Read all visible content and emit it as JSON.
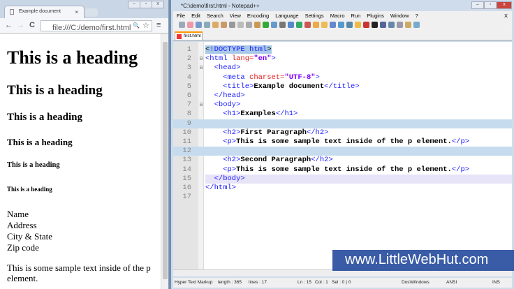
{
  "browser": {
    "tab_title": "Example document",
    "tab_close": "×",
    "url": "file:///C:/demo/first.html",
    "back": "←",
    "forward": "→",
    "reload": "C",
    "zoom_icon": "🔍",
    "star": "☆",
    "menu": "≡",
    "content": {
      "headings": [
        "This is a heading",
        "This is a heading",
        "This is a heading",
        "This is a heading",
        "This is a heading",
        "This is a heading"
      ],
      "address_lines": [
        "Name",
        "Address",
        "City & State",
        "Zip code"
      ],
      "paragraph": "This is some sample text inside of the p element."
    }
  },
  "npp": {
    "title": "*C:\\demo\\first.html - Notepad++",
    "menu": [
      "File",
      "Edit",
      "Search",
      "View",
      "Encoding",
      "Language",
      "Settings",
      "Macro",
      "Run",
      "Plugins",
      "Window",
      "?"
    ],
    "menu_close": "X",
    "tab": "first.html",
    "status": {
      "lang": "Hyper Text Markup",
      "length": "length : 365",
      "lines": "lines : 17",
      "ln": "Ln : 15",
      "col": "Col : 1",
      "sel": "Sel : 0 | 0",
      "eol": "Dos\\Windows",
      "enc": "ANSI",
      "mode": "INS"
    },
    "line_numbers": [
      "1",
      "2",
      "3",
      "4",
      "5",
      "6",
      "7",
      "8",
      "9",
      "10",
      "11",
      "12",
      "13",
      "14",
      "15",
      "16",
      "17"
    ]
  },
  "code": {
    "l1a": "<",
    "l1b": "!DOCTYPE html",
    "l1c": ">",
    "l2a": "<html ",
    "l2b": "lang=",
    "l2c": "\"en\"",
    "l2d": ">",
    "l3": "  <head>",
    "l4a": "    <meta ",
    "l4b": "charset=",
    "l4c": "\"UTF-8\"",
    "l4d": ">",
    "l5a": "    <title>",
    "l5b": "Example document",
    "l5c": "</title>",
    "l6": "  </head>",
    "l7": "  <body>",
    "l8a": "    <h1>",
    "l8b": "Examples",
    "l8c": "</h1>",
    "l10a": "    <h2>",
    "l10b": "First Paragraph",
    "l10c": "</h2>",
    "l11a": "    <p>",
    "l11b": "This is some sample text inside of the p element.",
    "l11c": "</p>",
    "l13a": "    <h2>",
    "l13b": "Second Paragraph",
    "l13c": "</h2>",
    "l14a": "    <p>",
    "l14b": "This is some sample text inside of the p element.",
    "l14c": "</p>",
    "l15": "  </body>",
    "l16": "</html>"
  },
  "watermark": "www.LittleWebHut.com"
}
